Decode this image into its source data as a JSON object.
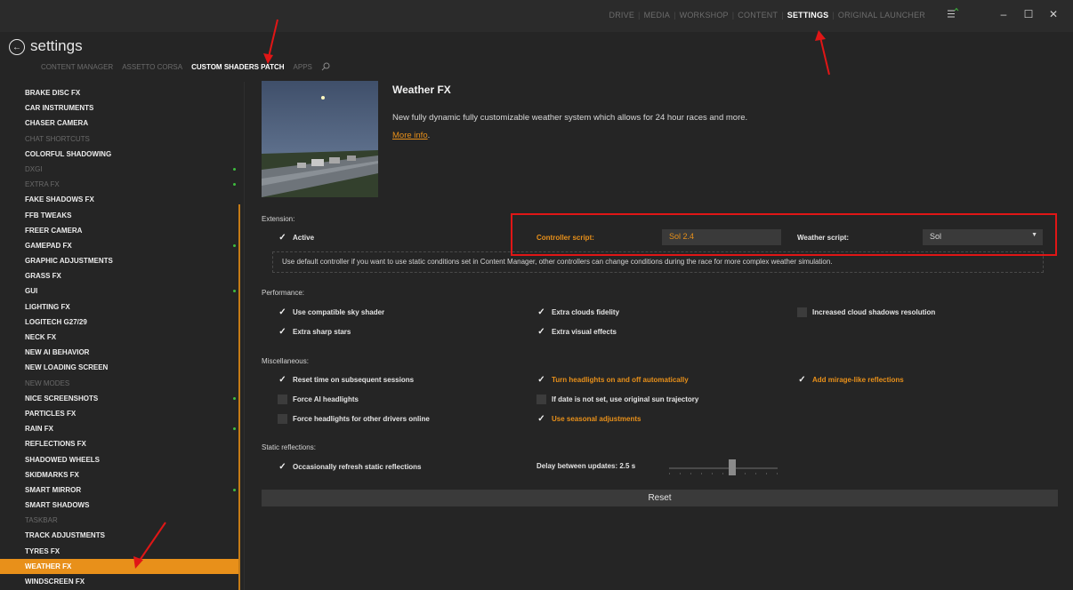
{
  "top_nav": {
    "items": [
      {
        "label": "DRIVE"
      },
      {
        "label": "MEDIA"
      },
      {
        "label": "WORKSHOP"
      },
      {
        "label": "CONTENT"
      },
      {
        "label": "SETTINGS"
      },
      {
        "label": "ORIGINAL LAUNCHER"
      }
    ],
    "active_index": 4
  },
  "window_controls": {
    "minimize": "–",
    "maximize": "☐",
    "close": "✕"
  },
  "header": {
    "title": "settings",
    "back_icon": "back-arrow-icon"
  },
  "sub_nav": {
    "items": [
      {
        "label": "CONTENT MANAGER"
      },
      {
        "label": "ASSETTO CORSA"
      },
      {
        "label": "CUSTOM SHADERS PATCH"
      },
      {
        "label": "APPS"
      }
    ],
    "active_index": 2,
    "search_icon": "search-icon"
  },
  "sidebar": {
    "items": [
      {
        "label": "BRAKE DISC FX",
        "dim": false,
        "dot": false
      },
      {
        "label": "CAR INSTRUMENTS",
        "dim": false,
        "dot": false
      },
      {
        "label": "CHASER CAMERA",
        "dim": false,
        "dot": false
      },
      {
        "label": "CHAT SHORTCUTS",
        "dim": true,
        "dot": false
      },
      {
        "label": "COLORFUL SHADOWING",
        "dim": false,
        "dot": false
      },
      {
        "label": "DXGI",
        "dim": true,
        "dot": true
      },
      {
        "label": "EXTRA FX",
        "dim": true,
        "dot": true
      },
      {
        "label": "FAKE SHADOWS FX",
        "dim": false,
        "dot": false
      },
      {
        "label": "FFB TWEAKS",
        "dim": false,
        "dot": false
      },
      {
        "label": "FREER CAMERA",
        "dim": false,
        "dot": false
      },
      {
        "label": "GAMEPAD FX",
        "dim": false,
        "dot": true
      },
      {
        "label": "GRAPHIC ADJUSTMENTS",
        "dim": false,
        "dot": false
      },
      {
        "label": "GRASS FX",
        "dim": false,
        "dot": false
      },
      {
        "label": "GUI",
        "dim": false,
        "dot": true
      },
      {
        "label": "LIGHTING FX",
        "dim": false,
        "dot": false
      },
      {
        "label": "LOGITECH G27/29",
        "dim": false,
        "dot": false
      },
      {
        "label": "NECK FX",
        "dim": false,
        "dot": false
      },
      {
        "label": "NEW AI BEHAVIOR",
        "dim": false,
        "dot": false
      },
      {
        "label": "NEW LOADING SCREEN",
        "dim": false,
        "dot": false
      },
      {
        "label": "NEW MODES",
        "dim": true,
        "dot": false
      },
      {
        "label": "NICE SCREENSHOTS",
        "dim": false,
        "dot": true
      },
      {
        "label": "PARTICLES FX",
        "dim": false,
        "dot": false
      },
      {
        "label": "RAIN FX",
        "dim": false,
        "dot": true
      },
      {
        "label": "REFLECTIONS FX",
        "dim": false,
        "dot": false
      },
      {
        "label": "SHADOWED WHEELS",
        "dim": false,
        "dot": false
      },
      {
        "label": "SKIDMARKS FX",
        "dim": false,
        "dot": false
      },
      {
        "label": "SMART MIRROR",
        "dim": false,
        "dot": true
      },
      {
        "label": "SMART SHADOWS",
        "dim": false,
        "dot": false
      },
      {
        "label": "TASKBAR",
        "dim": true,
        "dot": false
      },
      {
        "label": "TRACK ADJUSTMENTS",
        "dim": false,
        "dot": false
      },
      {
        "label": "TYRES FX",
        "dim": false,
        "dot": false
      },
      {
        "label": "WEATHER FX",
        "dim": false,
        "dot": false
      },
      {
        "label": "WINDSCREEN FX",
        "dim": false,
        "dot": false
      }
    ],
    "selected_index": 31
  },
  "main": {
    "title": "Weather FX",
    "description": "New fully dynamic fully customizable weather system which allows for 24 hour races and more.",
    "more_info_link": "More info",
    "more_info_suffix": ".",
    "extension": {
      "section_title": "Extension:",
      "active_label": "Active",
      "active_checked": true,
      "controller_label": "Controller script:",
      "controller_value": "Sol 2.4",
      "weather_label": "Weather script:",
      "weather_value": "Sol",
      "hint": "Use default controller if you want to use static conditions set in Content Manager, other controllers can change conditions during the race for more complex weather simulation."
    },
    "performance": {
      "section_title": "Performance:",
      "options": [
        {
          "label": "Use compatible sky shader",
          "checked": true
        },
        {
          "label": "Extra clouds fidelity",
          "checked": true
        },
        {
          "label": "Increased cloud shadows resolution",
          "checked": false
        },
        {
          "label": "Extra sharp stars",
          "checked": true
        },
        {
          "label": "Extra visual effects",
          "checked": true
        }
      ]
    },
    "misc": {
      "section_title": "Miscellaneous:",
      "options": [
        {
          "label": "Reset time on subsequent sessions",
          "checked": true,
          "highlight": false
        },
        {
          "label": "Turn headlights on and off automatically",
          "checked": true,
          "highlight": true
        },
        {
          "label": "Add mirage-like reflections",
          "checked": true,
          "highlight": true
        },
        {
          "label": "Force AI headlights",
          "checked": false,
          "highlight": false
        },
        {
          "label": "If date is not set, use original sun trajectory",
          "checked": false,
          "highlight": false
        },
        {
          "label": "Force headlights for other drivers online",
          "checked": false,
          "highlight": false
        },
        {
          "label": "Use seasonal adjustments",
          "checked": true,
          "highlight": true
        }
      ]
    },
    "static_reflections": {
      "section_title": "Static reflections:",
      "refresh_label": "Occasionally refresh static reflections",
      "refresh_checked": true,
      "delay_label": "Delay between updates: 2.5 s",
      "delay_fraction": 0.58
    },
    "reset_label": "Reset"
  },
  "colors": {
    "accent": "#e8901a",
    "background": "#252525",
    "annotation": "#e01616",
    "dot": "#3ebd3e"
  }
}
